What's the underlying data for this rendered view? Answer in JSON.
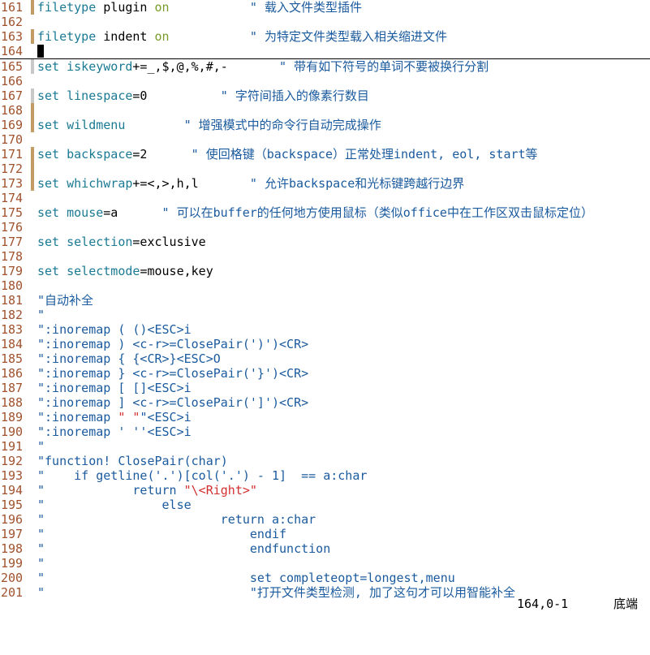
{
  "editor": {
    "lines": [
      {
        "n": "161",
        "g": "brown",
        "segs": [
          {
            "t": "filetype",
            "c": "kw"
          },
          {
            "t": " plugin "
          },
          {
            "t": "on",
            "c": "val"
          },
          {
            "t": "           \" 载入文件类型插件",
            "c": "cm"
          }
        ]
      },
      {
        "n": "162",
        "g": "",
        "segs": []
      },
      {
        "n": "163",
        "g": "brown",
        "segs": [
          {
            "t": "filetype",
            "c": "kw"
          },
          {
            "t": " indent "
          },
          {
            "t": "on",
            "c": "val"
          },
          {
            "t": "           \" 为特定文件类型载入相关缩进文件",
            "c": "cm"
          }
        ]
      },
      {
        "n": "164",
        "g": "",
        "segs": [],
        "cursor": true
      },
      {
        "n": "165",
        "g": "gray",
        "segs": [
          {
            "t": "set",
            "c": "kw"
          },
          {
            "t": " "
          },
          {
            "t": "iskeyword",
            "c": "kw"
          },
          {
            "t": "+=_,$,@,%,#,-       "
          },
          {
            "t": "\" 带有如下符号的单词不要被换行分割",
            "c": "cm"
          }
        ]
      },
      {
        "n": "166",
        "g": "",
        "segs": []
      },
      {
        "n": "167",
        "g": "gray",
        "segs": [
          {
            "t": "set",
            "c": "kw"
          },
          {
            "t": " "
          },
          {
            "t": "linespace",
            "c": "kw"
          },
          {
            "t": "=0          "
          },
          {
            "t": "\" 字符间插入的像素行数目",
            "c": "cm"
          }
        ]
      },
      {
        "n": "168",
        "g": "brown",
        "segs": []
      },
      {
        "n": "169",
        "g": "brown",
        "segs": [
          {
            "t": "set",
            "c": "kw"
          },
          {
            "t": " "
          },
          {
            "t": "wildmenu",
            "c": "kw"
          },
          {
            "t": "        "
          },
          {
            "t": "\" 增强模式中的命令行自动完成操作",
            "c": "cm"
          }
        ]
      },
      {
        "n": "170",
        "g": "",
        "segs": []
      },
      {
        "n": "171",
        "g": "brown",
        "segs": [
          {
            "t": "set",
            "c": "kw"
          },
          {
            "t": " "
          },
          {
            "t": "backspace",
            "c": "kw"
          },
          {
            "t": "=2      "
          },
          {
            "t": "\" 使回格键（backspace）正常处理indent, eol, start等",
            "c": "cm"
          }
        ]
      },
      {
        "n": "172",
        "g": "brown",
        "segs": []
      },
      {
        "n": "173",
        "g": "brown",
        "segs": [
          {
            "t": "set",
            "c": "kw"
          },
          {
            "t": " "
          },
          {
            "t": "whichwrap",
            "c": "kw"
          },
          {
            "t": "+=<,>,h,l       "
          },
          {
            "t": "\" 允许backspace和光标键跨越行边界",
            "c": "cm"
          }
        ]
      },
      {
        "n": "174",
        "g": "",
        "segs": []
      },
      {
        "n": "175",
        "g": "",
        "segs": [
          {
            "t": "set",
            "c": "kw"
          },
          {
            "t": " "
          },
          {
            "t": "mouse",
            "c": "kw"
          },
          {
            "t": "=a      "
          },
          {
            "t": "\" 可以在buffer的任何地方使用鼠标（类似office中在工作区双击鼠标定位）",
            "c": "cm"
          }
        ]
      },
      {
        "n": "176",
        "g": "",
        "segs": []
      },
      {
        "n": "177",
        "g": "",
        "segs": [
          {
            "t": "set",
            "c": "kw"
          },
          {
            "t": " "
          },
          {
            "t": "selection",
            "c": "kw"
          },
          {
            "t": "=exclusive"
          }
        ]
      },
      {
        "n": "178",
        "g": "",
        "segs": []
      },
      {
        "n": "179",
        "g": "",
        "segs": [
          {
            "t": "set",
            "c": "kw"
          },
          {
            "t": " "
          },
          {
            "t": "selectmode",
            "c": "kw"
          },
          {
            "t": "=mouse,key"
          }
        ]
      },
      {
        "n": "180",
        "g": "",
        "segs": []
      },
      {
        "n": "181",
        "g": "",
        "segs": [
          {
            "t": "\"自动补全",
            "c": "cm"
          }
        ]
      },
      {
        "n": "182",
        "g": "",
        "segs": [
          {
            "t": "\"",
            "c": "cm"
          }
        ]
      },
      {
        "n": "183",
        "g": "",
        "segs": [
          {
            "t": "\":inoremap ( ()<ESC>i",
            "c": "cm"
          }
        ]
      },
      {
        "n": "184",
        "g": "",
        "segs": [
          {
            "t": "\":inoremap ) <c-r>=ClosePair(')')<CR>",
            "c": "cm"
          }
        ]
      },
      {
        "n": "185",
        "g": "",
        "segs": [
          {
            "t": "\":inoremap { {<CR>}<ESC>O",
            "c": "cm"
          }
        ]
      },
      {
        "n": "186",
        "g": "",
        "segs": [
          {
            "t": "\":inoremap } <c-r>=ClosePair('}')<CR>",
            "c": "cm"
          }
        ]
      },
      {
        "n": "187",
        "g": "",
        "segs": [
          {
            "t": "\":inoremap [ []<ESC>i",
            "c": "cm"
          }
        ]
      },
      {
        "n": "188",
        "g": "",
        "segs": [
          {
            "t": "\":inoremap ] <c-r>=ClosePair(']')<CR>",
            "c": "cm"
          }
        ]
      },
      {
        "n": "189",
        "g": "",
        "segs": [
          {
            "t": "\":inoremap ",
            "c": "cm"
          },
          {
            "t": "\" \"",
            "c": "str"
          },
          {
            "t": "\"<ESC>i",
            "c": "cm"
          }
        ]
      },
      {
        "n": "190",
        "g": "",
        "segs": [
          {
            "t": "\":inoremap ' ''<ESC>i",
            "c": "cm"
          }
        ]
      },
      {
        "n": "191",
        "g": "",
        "segs": [
          {
            "t": "\"",
            "c": "cm"
          }
        ]
      },
      {
        "n": "192",
        "g": "",
        "segs": [
          {
            "t": "\"function! ClosePair(char)",
            "c": "cm"
          }
        ]
      },
      {
        "n": "193",
        "g": "",
        "segs": [
          {
            "t": "\"    if getline('.')[col('.') - 1]  == a:char",
            "c": "cm"
          }
        ]
      },
      {
        "n": "194",
        "g": "",
        "segs": [
          {
            "t": "\"            return ",
            "c": "cm"
          },
          {
            "t": "\"\\<Right>\"",
            "c": "str"
          }
        ]
      },
      {
        "n": "195",
        "g": "",
        "segs": [
          {
            "t": "\"                else",
            "c": "cm"
          }
        ]
      },
      {
        "n": "196",
        "g": "",
        "segs": [
          {
            "t": "\"                        return a:char",
            "c": "cm"
          }
        ]
      },
      {
        "n": "197",
        "g": "",
        "segs": [
          {
            "t": "\"                            endif",
            "c": "cm"
          }
        ]
      },
      {
        "n": "198",
        "g": "",
        "segs": [
          {
            "t": "\"                            endfunction",
            "c": "cm"
          }
        ]
      },
      {
        "n": "199",
        "g": "",
        "segs": [
          {
            "t": "\"",
            "c": "cm"
          }
        ]
      },
      {
        "n": "200",
        "g": "",
        "segs": [
          {
            "t": "\"                            set completeopt=longest,menu",
            "c": "cm"
          }
        ]
      },
      {
        "n": "201",
        "g": "",
        "segs": [
          {
            "t": "\"                            \"打开文件类型检测, 加了这句才可以用智能补全",
            "c": "cm"
          }
        ]
      }
    ]
  },
  "status": {
    "position": "164,0-1",
    "scroll": "底端"
  }
}
